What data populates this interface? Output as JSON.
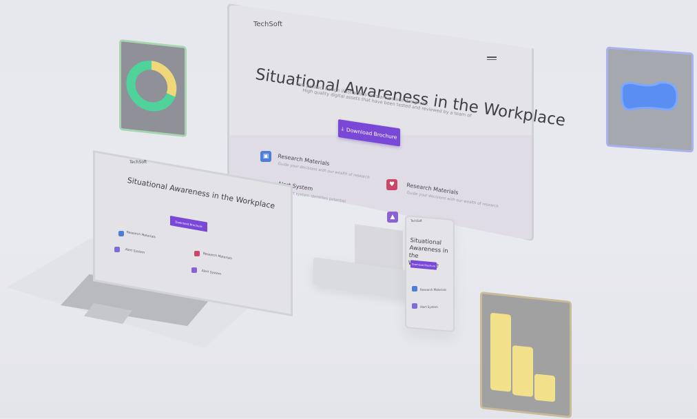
{
  "brand": "TechSoft",
  "hero": {
    "title": "Situational Awareness in the Workplace",
    "subtitle_line1": "Free product design illustrations for startups and designers.",
    "subtitle_line2": "High quality digital assets that have been tested and reviewed by a team of",
    "cta_label": "Download Brochure",
    "cta_icon": "download-icon"
  },
  "features": [
    {
      "title": "Research Materials",
      "desc": "Guide your decisions with our wealth of research",
      "icon": "book-icon",
      "color": "#4e7fd8"
    },
    {
      "title": "Alert System",
      "desc": "Our alert system identifies potential",
      "icon": "bell-icon",
      "color": "#7b6fd6"
    },
    {
      "title": "Research Materials",
      "desc": "Guide your decisions with our wealth of research",
      "icon": "heart-doc-icon",
      "color": "#c9486a"
    },
    {
      "title": "Alert System",
      "desc": "Our alert system identifies potential",
      "icon": "bell-icon",
      "color": "#8a63d2"
    }
  ],
  "phone": {
    "title": "Situational Awareness in the Workplace",
    "cta_label": "Download Brochure"
  },
  "colors": {
    "accent": "#7a48d6",
    "donut_green": "#4fd39a",
    "donut_yellow": "#f2d77a",
    "blob_blue": "#5a8ef0",
    "bars_yellow": "#f2e08a"
  }
}
